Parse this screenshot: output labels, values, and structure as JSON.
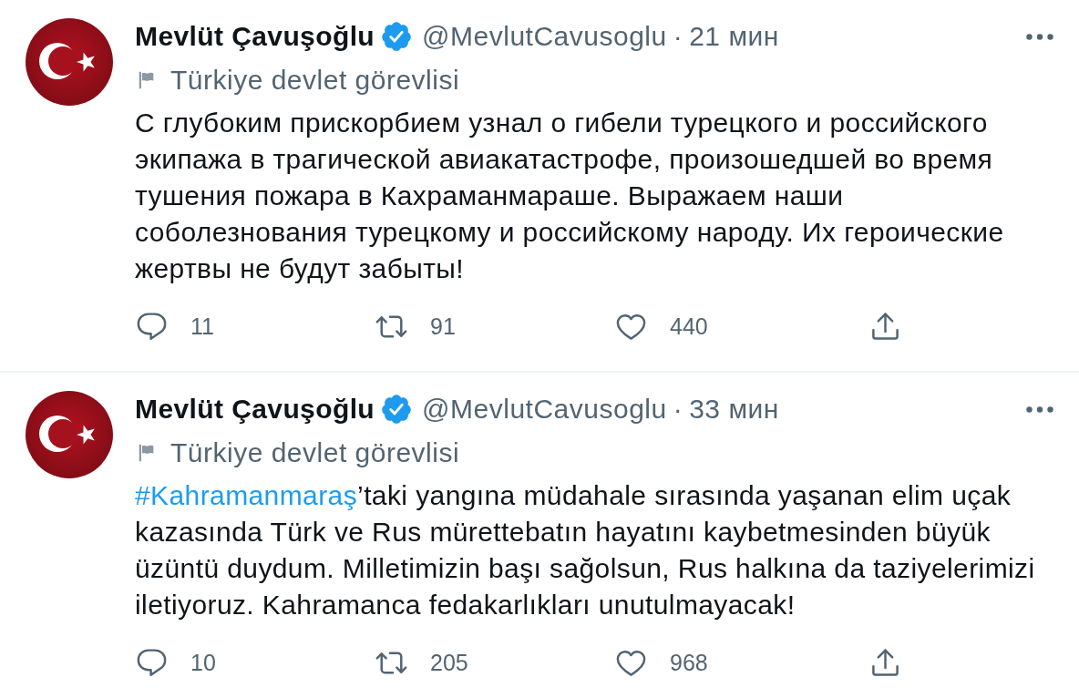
{
  "tweets": [
    {
      "author": {
        "name": "Mevlüt Çavuşoğlu",
        "verified": true,
        "handle": "@MevlutCavusoglu"
      },
      "separator": "·",
      "time": "21 мин",
      "label": "Türkiye devlet görevlisi",
      "body": [
        {
          "kind": "text",
          "text": "С глубоким прискорбием узнал о гибели турецкого и российского экипажа в трагической авиакатастрофе, произошедшей во время тушения пожара в Кахраманмараше. Выражаем наши соболезнования турецкому и российскому народу. Их героические жертвы не будут забыты!"
        }
      ],
      "actions": [
        {
          "kind": "reply",
          "count": "11"
        },
        {
          "kind": "retweet",
          "count": "91"
        },
        {
          "kind": "like",
          "count": "440"
        },
        {
          "kind": "share"
        }
      ]
    },
    {
      "author": {
        "name": "Mevlüt Çavuşoğlu",
        "verified": true,
        "handle": "@MevlutCavusoglu"
      },
      "separator": "·",
      "time": "33 мин",
      "label": "Türkiye devlet görevlisi",
      "body": [
        {
          "kind": "hashtag",
          "text": "#Kahramanmaraş"
        },
        {
          "kind": "text",
          "text": "’taki yangına müdahale sırasında yaşanan elim uçak kazasında Türk ve Rus mürettebatın hayatını kaybetmesinden büyük üzüntü duydum. Milletimizin başı sağolsun, Rus halkına da taziyelerimizi iletiyoruz. Kahramanca fedakarlıkları unutulmayacak!"
        }
      ],
      "actions": [
        {
          "kind": "reply",
          "count": "10"
        },
        {
          "kind": "retweet",
          "count": "205"
        },
        {
          "kind": "like",
          "count": "968"
        },
        {
          "kind": "share"
        }
      ]
    }
  ]
}
